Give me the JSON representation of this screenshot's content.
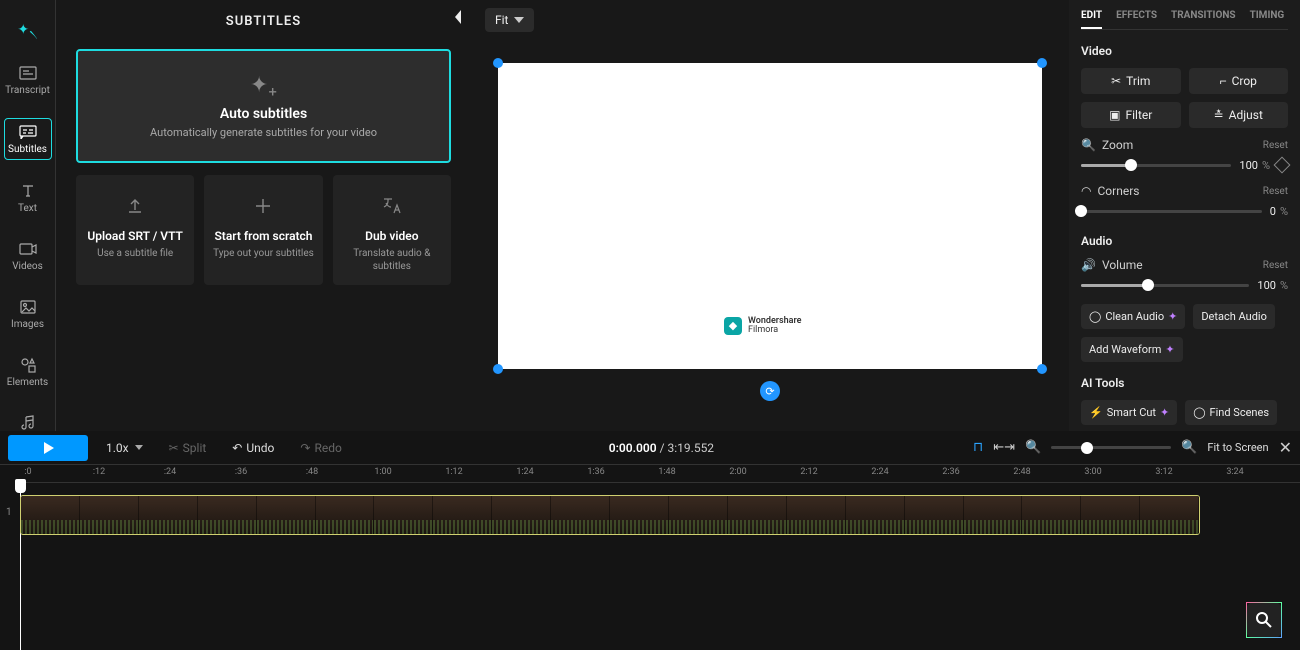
{
  "leftpanel": {
    "title": "SUBTITLES",
    "autosub": {
      "title": "Auto subtitles",
      "desc": "Automatically generate subtitles for your video"
    },
    "cards": [
      {
        "title": "Upload SRT / VTT",
        "desc": "Use a subtitle file"
      },
      {
        "title": "Start from scratch",
        "desc": "Type out your subtitles"
      },
      {
        "title": "Dub video",
        "desc": "Translate audio & subtitles"
      }
    ]
  },
  "sidebar": {
    "items": [
      {
        "label": "Transcript"
      },
      {
        "label": "Subtitles"
      },
      {
        "label": "Text"
      },
      {
        "label": "Videos"
      },
      {
        "label": "Images"
      },
      {
        "label": "Elements"
      },
      {
        "label": "Audio"
      }
    ]
  },
  "canvas": {
    "fit": "Fit",
    "watermark_brand": "Wondershare",
    "watermark_product": "Filmora"
  },
  "right": {
    "tabs": [
      "EDIT",
      "EFFECTS",
      "TRANSITIONS",
      "TIMING"
    ],
    "video": {
      "heading": "Video",
      "trim": "Trim",
      "crop": "Crop",
      "filter": "Filter",
      "adjust": "Adjust",
      "zoom_label": "Zoom",
      "zoom_reset": "Reset",
      "zoom_value": "100",
      "zoom_unit": "%",
      "corners_label": "Corners",
      "corners_reset": "Reset",
      "corners_value": "0",
      "corners_unit": "%"
    },
    "audio": {
      "heading": "Audio",
      "volume_label": "Volume",
      "volume_reset": "Reset",
      "volume_value": "100",
      "volume_unit": "%",
      "clean": "Clean Audio",
      "detach": "Detach Audio",
      "waveform": "Add Waveform"
    },
    "ai": {
      "heading": "AI Tools",
      "smartcut": "Smart Cut",
      "findscenes": "Find Scenes"
    }
  },
  "controls": {
    "speed": "1.0x",
    "split": "Split",
    "undo": "Undo",
    "redo": "Redo",
    "current_time": "0:00.000",
    "duration": "3:19.552",
    "fit_to_screen": "Fit to Screen"
  },
  "ruler": [
    ":0",
    ":12",
    ":24",
    ":36",
    ":48",
    "1:00",
    "1:12",
    "1:24",
    "1:36",
    "1:48",
    "2:00",
    "2:12",
    "2:24",
    "2:36",
    "2:48",
    "3:00",
    "3:12",
    "3:24"
  ],
  "track_number": "1"
}
